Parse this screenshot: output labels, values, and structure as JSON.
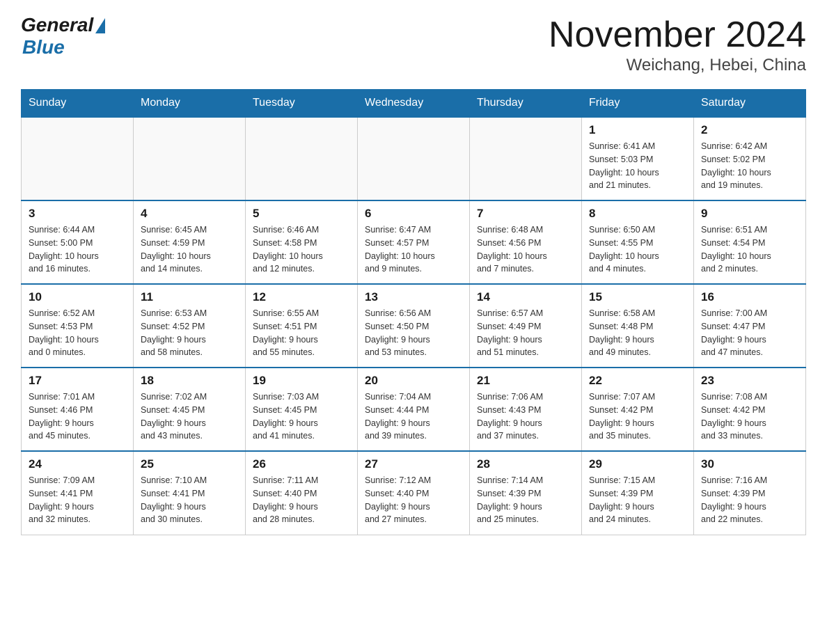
{
  "logo": {
    "general": "General",
    "blue": "Blue"
  },
  "title": "November 2024",
  "subtitle": "Weichang, Hebei, China",
  "days_of_week": [
    "Sunday",
    "Monday",
    "Tuesday",
    "Wednesday",
    "Thursday",
    "Friday",
    "Saturday"
  ],
  "weeks": [
    [
      {
        "day": "",
        "info": ""
      },
      {
        "day": "",
        "info": ""
      },
      {
        "day": "",
        "info": ""
      },
      {
        "day": "",
        "info": ""
      },
      {
        "day": "",
        "info": ""
      },
      {
        "day": "1",
        "info": "Sunrise: 6:41 AM\nSunset: 5:03 PM\nDaylight: 10 hours\nand 21 minutes."
      },
      {
        "day": "2",
        "info": "Sunrise: 6:42 AM\nSunset: 5:02 PM\nDaylight: 10 hours\nand 19 minutes."
      }
    ],
    [
      {
        "day": "3",
        "info": "Sunrise: 6:44 AM\nSunset: 5:00 PM\nDaylight: 10 hours\nand 16 minutes."
      },
      {
        "day": "4",
        "info": "Sunrise: 6:45 AM\nSunset: 4:59 PM\nDaylight: 10 hours\nand 14 minutes."
      },
      {
        "day": "5",
        "info": "Sunrise: 6:46 AM\nSunset: 4:58 PM\nDaylight: 10 hours\nand 12 minutes."
      },
      {
        "day": "6",
        "info": "Sunrise: 6:47 AM\nSunset: 4:57 PM\nDaylight: 10 hours\nand 9 minutes."
      },
      {
        "day": "7",
        "info": "Sunrise: 6:48 AM\nSunset: 4:56 PM\nDaylight: 10 hours\nand 7 minutes."
      },
      {
        "day": "8",
        "info": "Sunrise: 6:50 AM\nSunset: 4:55 PM\nDaylight: 10 hours\nand 4 minutes."
      },
      {
        "day": "9",
        "info": "Sunrise: 6:51 AM\nSunset: 4:54 PM\nDaylight: 10 hours\nand 2 minutes."
      }
    ],
    [
      {
        "day": "10",
        "info": "Sunrise: 6:52 AM\nSunset: 4:53 PM\nDaylight: 10 hours\nand 0 minutes."
      },
      {
        "day": "11",
        "info": "Sunrise: 6:53 AM\nSunset: 4:52 PM\nDaylight: 9 hours\nand 58 minutes."
      },
      {
        "day": "12",
        "info": "Sunrise: 6:55 AM\nSunset: 4:51 PM\nDaylight: 9 hours\nand 55 minutes."
      },
      {
        "day": "13",
        "info": "Sunrise: 6:56 AM\nSunset: 4:50 PM\nDaylight: 9 hours\nand 53 minutes."
      },
      {
        "day": "14",
        "info": "Sunrise: 6:57 AM\nSunset: 4:49 PM\nDaylight: 9 hours\nand 51 minutes."
      },
      {
        "day": "15",
        "info": "Sunrise: 6:58 AM\nSunset: 4:48 PM\nDaylight: 9 hours\nand 49 minutes."
      },
      {
        "day": "16",
        "info": "Sunrise: 7:00 AM\nSunset: 4:47 PM\nDaylight: 9 hours\nand 47 minutes."
      }
    ],
    [
      {
        "day": "17",
        "info": "Sunrise: 7:01 AM\nSunset: 4:46 PM\nDaylight: 9 hours\nand 45 minutes."
      },
      {
        "day": "18",
        "info": "Sunrise: 7:02 AM\nSunset: 4:45 PM\nDaylight: 9 hours\nand 43 minutes."
      },
      {
        "day": "19",
        "info": "Sunrise: 7:03 AM\nSunset: 4:45 PM\nDaylight: 9 hours\nand 41 minutes."
      },
      {
        "day": "20",
        "info": "Sunrise: 7:04 AM\nSunset: 4:44 PM\nDaylight: 9 hours\nand 39 minutes."
      },
      {
        "day": "21",
        "info": "Sunrise: 7:06 AM\nSunset: 4:43 PM\nDaylight: 9 hours\nand 37 minutes."
      },
      {
        "day": "22",
        "info": "Sunrise: 7:07 AM\nSunset: 4:42 PM\nDaylight: 9 hours\nand 35 minutes."
      },
      {
        "day": "23",
        "info": "Sunrise: 7:08 AM\nSunset: 4:42 PM\nDaylight: 9 hours\nand 33 minutes."
      }
    ],
    [
      {
        "day": "24",
        "info": "Sunrise: 7:09 AM\nSunset: 4:41 PM\nDaylight: 9 hours\nand 32 minutes."
      },
      {
        "day": "25",
        "info": "Sunrise: 7:10 AM\nSunset: 4:41 PM\nDaylight: 9 hours\nand 30 minutes."
      },
      {
        "day": "26",
        "info": "Sunrise: 7:11 AM\nSunset: 4:40 PM\nDaylight: 9 hours\nand 28 minutes."
      },
      {
        "day": "27",
        "info": "Sunrise: 7:12 AM\nSunset: 4:40 PM\nDaylight: 9 hours\nand 27 minutes."
      },
      {
        "day": "28",
        "info": "Sunrise: 7:14 AM\nSunset: 4:39 PM\nDaylight: 9 hours\nand 25 minutes."
      },
      {
        "day": "29",
        "info": "Sunrise: 7:15 AM\nSunset: 4:39 PM\nDaylight: 9 hours\nand 24 minutes."
      },
      {
        "day": "30",
        "info": "Sunrise: 7:16 AM\nSunset: 4:39 PM\nDaylight: 9 hours\nand 22 minutes."
      }
    ]
  ]
}
